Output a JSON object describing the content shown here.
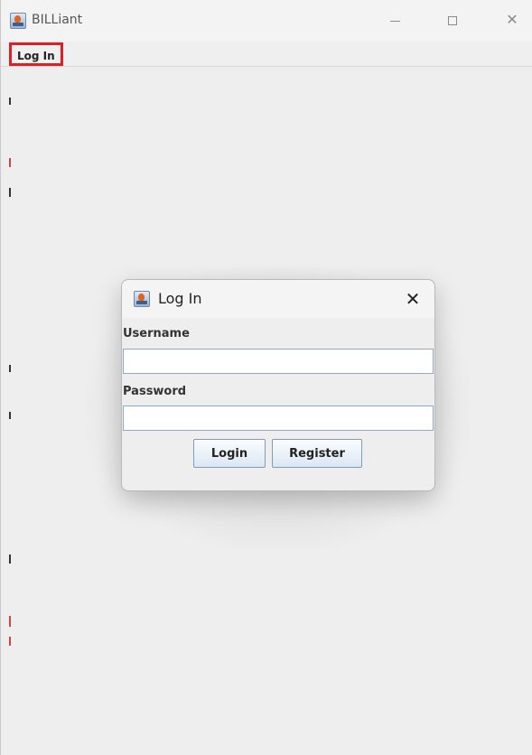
{
  "window": {
    "title": "BILLiant",
    "controls": {
      "minimize_icon": "minimize-icon",
      "maximize_icon": "maximize-icon",
      "close_symbol": "✕"
    }
  },
  "menubar": {
    "items": [
      {
        "label": "Log In"
      }
    ]
  },
  "dialog": {
    "title": "Log In",
    "close_symbol": "✕",
    "username_label": "Username",
    "username_value": "",
    "password_label": "Password",
    "password_value": "",
    "login_button": "Login",
    "register_button": "Register"
  },
  "colors": {
    "highlight_border": "#e11d25",
    "window_bg": "#eeeeee",
    "field_border": "#8fa8c6"
  }
}
